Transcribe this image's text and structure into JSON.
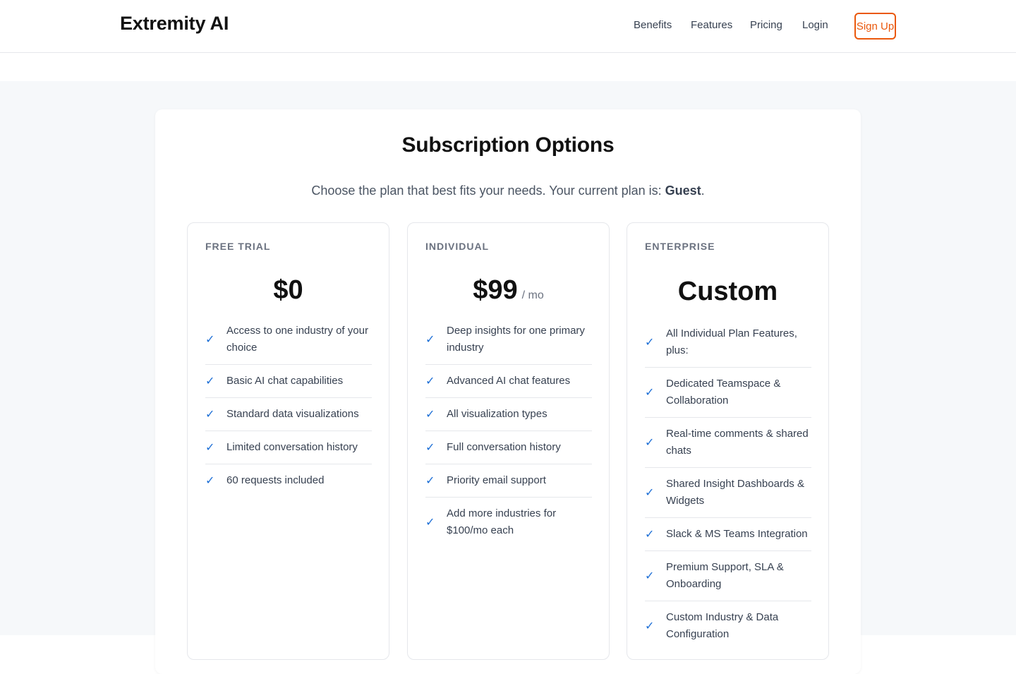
{
  "brand": "Extremity AI",
  "nav": {
    "links": [
      "Benefits",
      "Features",
      "Pricing",
      "Login"
    ],
    "signup": "Sign Up"
  },
  "main": {
    "title": "Subscription Options",
    "subtitle_prefix": "Choose the plan that best fits your needs. Your current plan is: ",
    "current_plan": "Guest",
    "subtitle_suffix": "."
  },
  "plans": [
    {
      "tier": "FREE TRIAL",
      "price": "$0",
      "period": "",
      "features": [
        "Access to one industry of your choice",
        "Basic AI chat capabilities",
        "Standard data visualizations",
        "Limited conversation history",
        "60 requests included"
      ]
    },
    {
      "tier": "INDIVIDUAL",
      "price": "$99",
      "period": "/ mo",
      "features": [
        "Deep insights for one primary industry",
        "Advanced AI chat features",
        "All visualization types",
        "Full conversation history",
        "Priority email support",
        "Add more industries for $100/mo each"
      ]
    },
    {
      "tier": "ENTERPRISE",
      "price": "Custom",
      "period": "",
      "features": [
        "All Individual Plan Features, plus:",
        "Dedicated Teamspace & Collaboration",
        "Real-time comments & shared chats",
        "Shared Insight Dashboards & Widgets",
        "Slack & MS Teams Integration",
        "Premium Support, SLA & Onboarding",
        "Custom Industry & Data Configuration"
      ]
    }
  ],
  "check_icon": "checkmark-icon",
  "colors": {
    "accent": "#ea580c",
    "check": "#1d6fd6",
    "band_bg": "#f6f8fa"
  }
}
